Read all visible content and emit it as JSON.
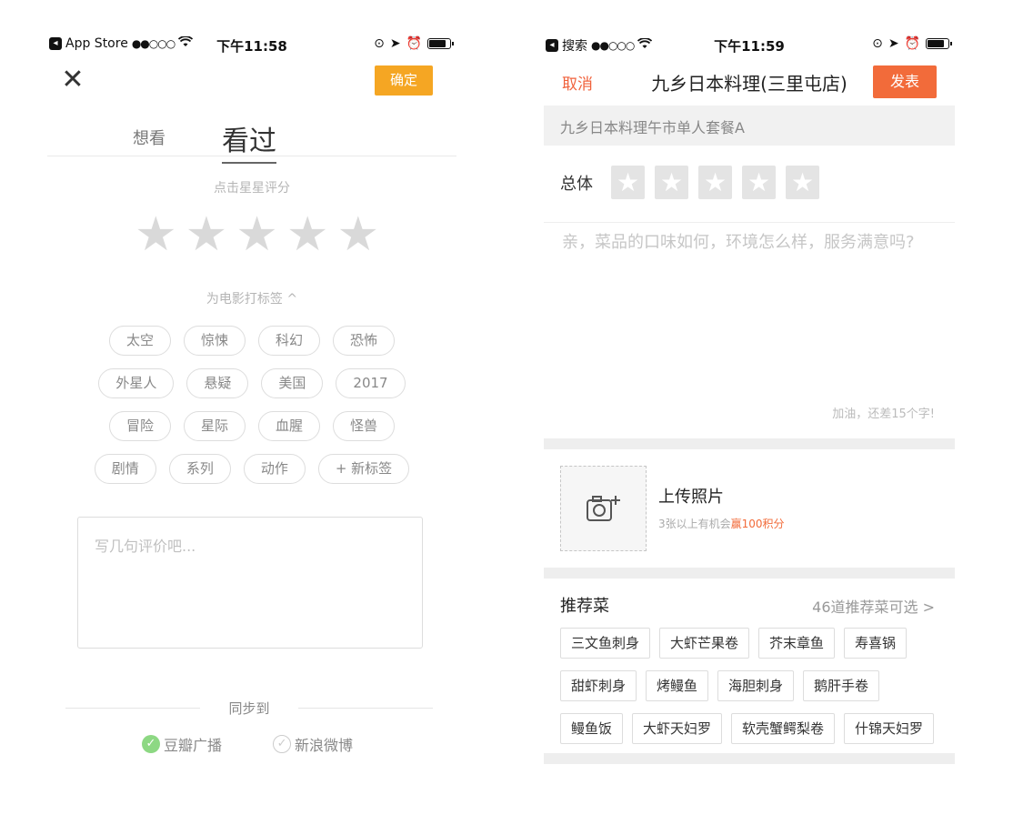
{
  "left": {
    "status": {
      "carrier": "App Store",
      "signal": "●●○○○",
      "time": "下午11:58"
    },
    "confirm_label": "确定",
    "tabs": [
      {
        "label": "想看"
      },
      {
        "label": "看过"
      }
    ],
    "rating_hint": "点击星星评分",
    "tag_title": "为电影打标签 ^",
    "tags": [
      [
        "太空",
        "惊悚",
        "科幻",
        "恐怖"
      ],
      [
        "外星人",
        "悬疑",
        "美国",
        "2017"
      ],
      [
        "冒险",
        "星际",
        "血腥",
        "怪兽"
      ],
      [
        "剧情",
        "系列",
        "动作",
        "+ 新标签"
      ]
    ],
    "review_placeholder": "写几句评价吧...",
    "sync_label": "同步到",
    "sync_options": [
      {
        "label": "豆瓣广播",
        "checked": true
      },
      {
        "label": "新浪微博",
        "checked": false
      }
    ]
  },
  "right": {
    "status": {
      "carrier": "搜索",
      "signal": "●●○○○",
      "time": "下午11:59"
    },
    "cancel_label": "取消",
    "title": "九乡日本料理(三里屯店)",
    "post_label": "发表",
    "dish_name": "九乡日本料理午市单人套餐A",
    "overall_label": "总体",
    "review_placeholder": "亲，菜品的口味如何，环境怎么样，服务满意吗?",
    "char_counter": "加油，还差15个字!",
    "upload_title": "上传照片",
    "upload_sub_prefix": "3张以上有机会",
    "upload_sub_accent": "赢100积分",
    "rec_title": "推荐菜",
    "rec_more": "46道推荐菜可选 >",
    "dishes": [
      [
        "三文鱼刺身",
        "大虾芒果卷",
        "芥末章鱼",
        "寿喜锅"
      ],
      [
        "甜虾刺身",
        "烤鳗鱼",
        "海胆刺身",
        "鹅肝手卷"
      ],
      [
        "鳗鱼饭",
        "大虾天妇罗",
        "软壳蟹鳄梨卷",
        "什锦天妇罗"
      ]
    ]
  },
  "colors": {
    "confirm": "#f5a623",
    "post": "#f26b3a",
    "check": "#8dd883"
  }
}
